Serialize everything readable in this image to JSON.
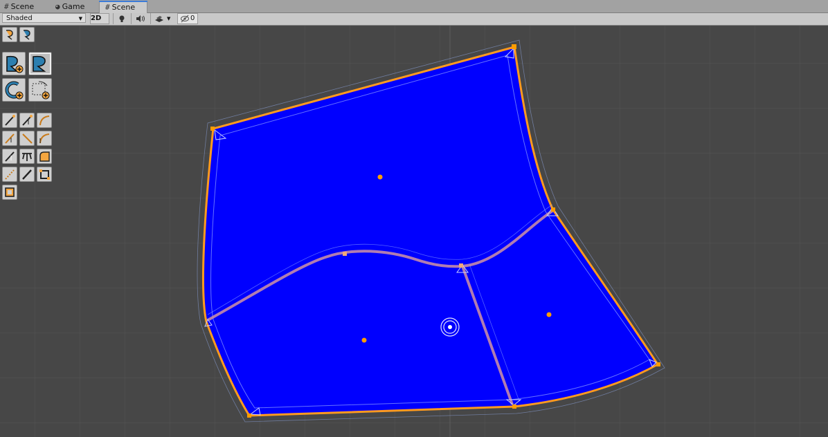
{
  "tabs": [
    {
      "label": "Scene",
      "icon": "grid-icon",
      "active": false
    },
    {
      "label": "Game",
      "icon": "pacman-icon",
      "active": false
    },
    {
      "label": "Scene",
      "icon": "grid-icon",
      "active": true
    }
  ],
  "toolbar": {
    "shading_mode": "Shaded",
    "mode_2d_label": "2D",
    "hidden_count": "0"
  },
  "colors": {
    "shape_fill": "#0000ff",
    "shape_outline": "#ff9a1f",
    "handle": "#ff9c00",
    "scene_bg": "#474747"
  },
  "tools": {
    "top_row": [
      "edit-shape-icon",
      "edit-collider-icon"
    ],
    "large": [
      "add-path-icon",
      "select-path-icon",
      "add-circle-icon",
      "add-rect-icon"
    ],
    "small": [
      "tangent-icon",
      "tangent-up-icon",
      "curve-icon",
      "tangent-mirror-icon",
      "line-icon",
      "curve-corner-icon",
      "split-icon",
      "cut-icon",
      "fill-corner-icon",
      "dotted-line-icon",
      "straight-icon",
      "rect-select-icon",
      "frame-select-icon"
    ]
  }
}
